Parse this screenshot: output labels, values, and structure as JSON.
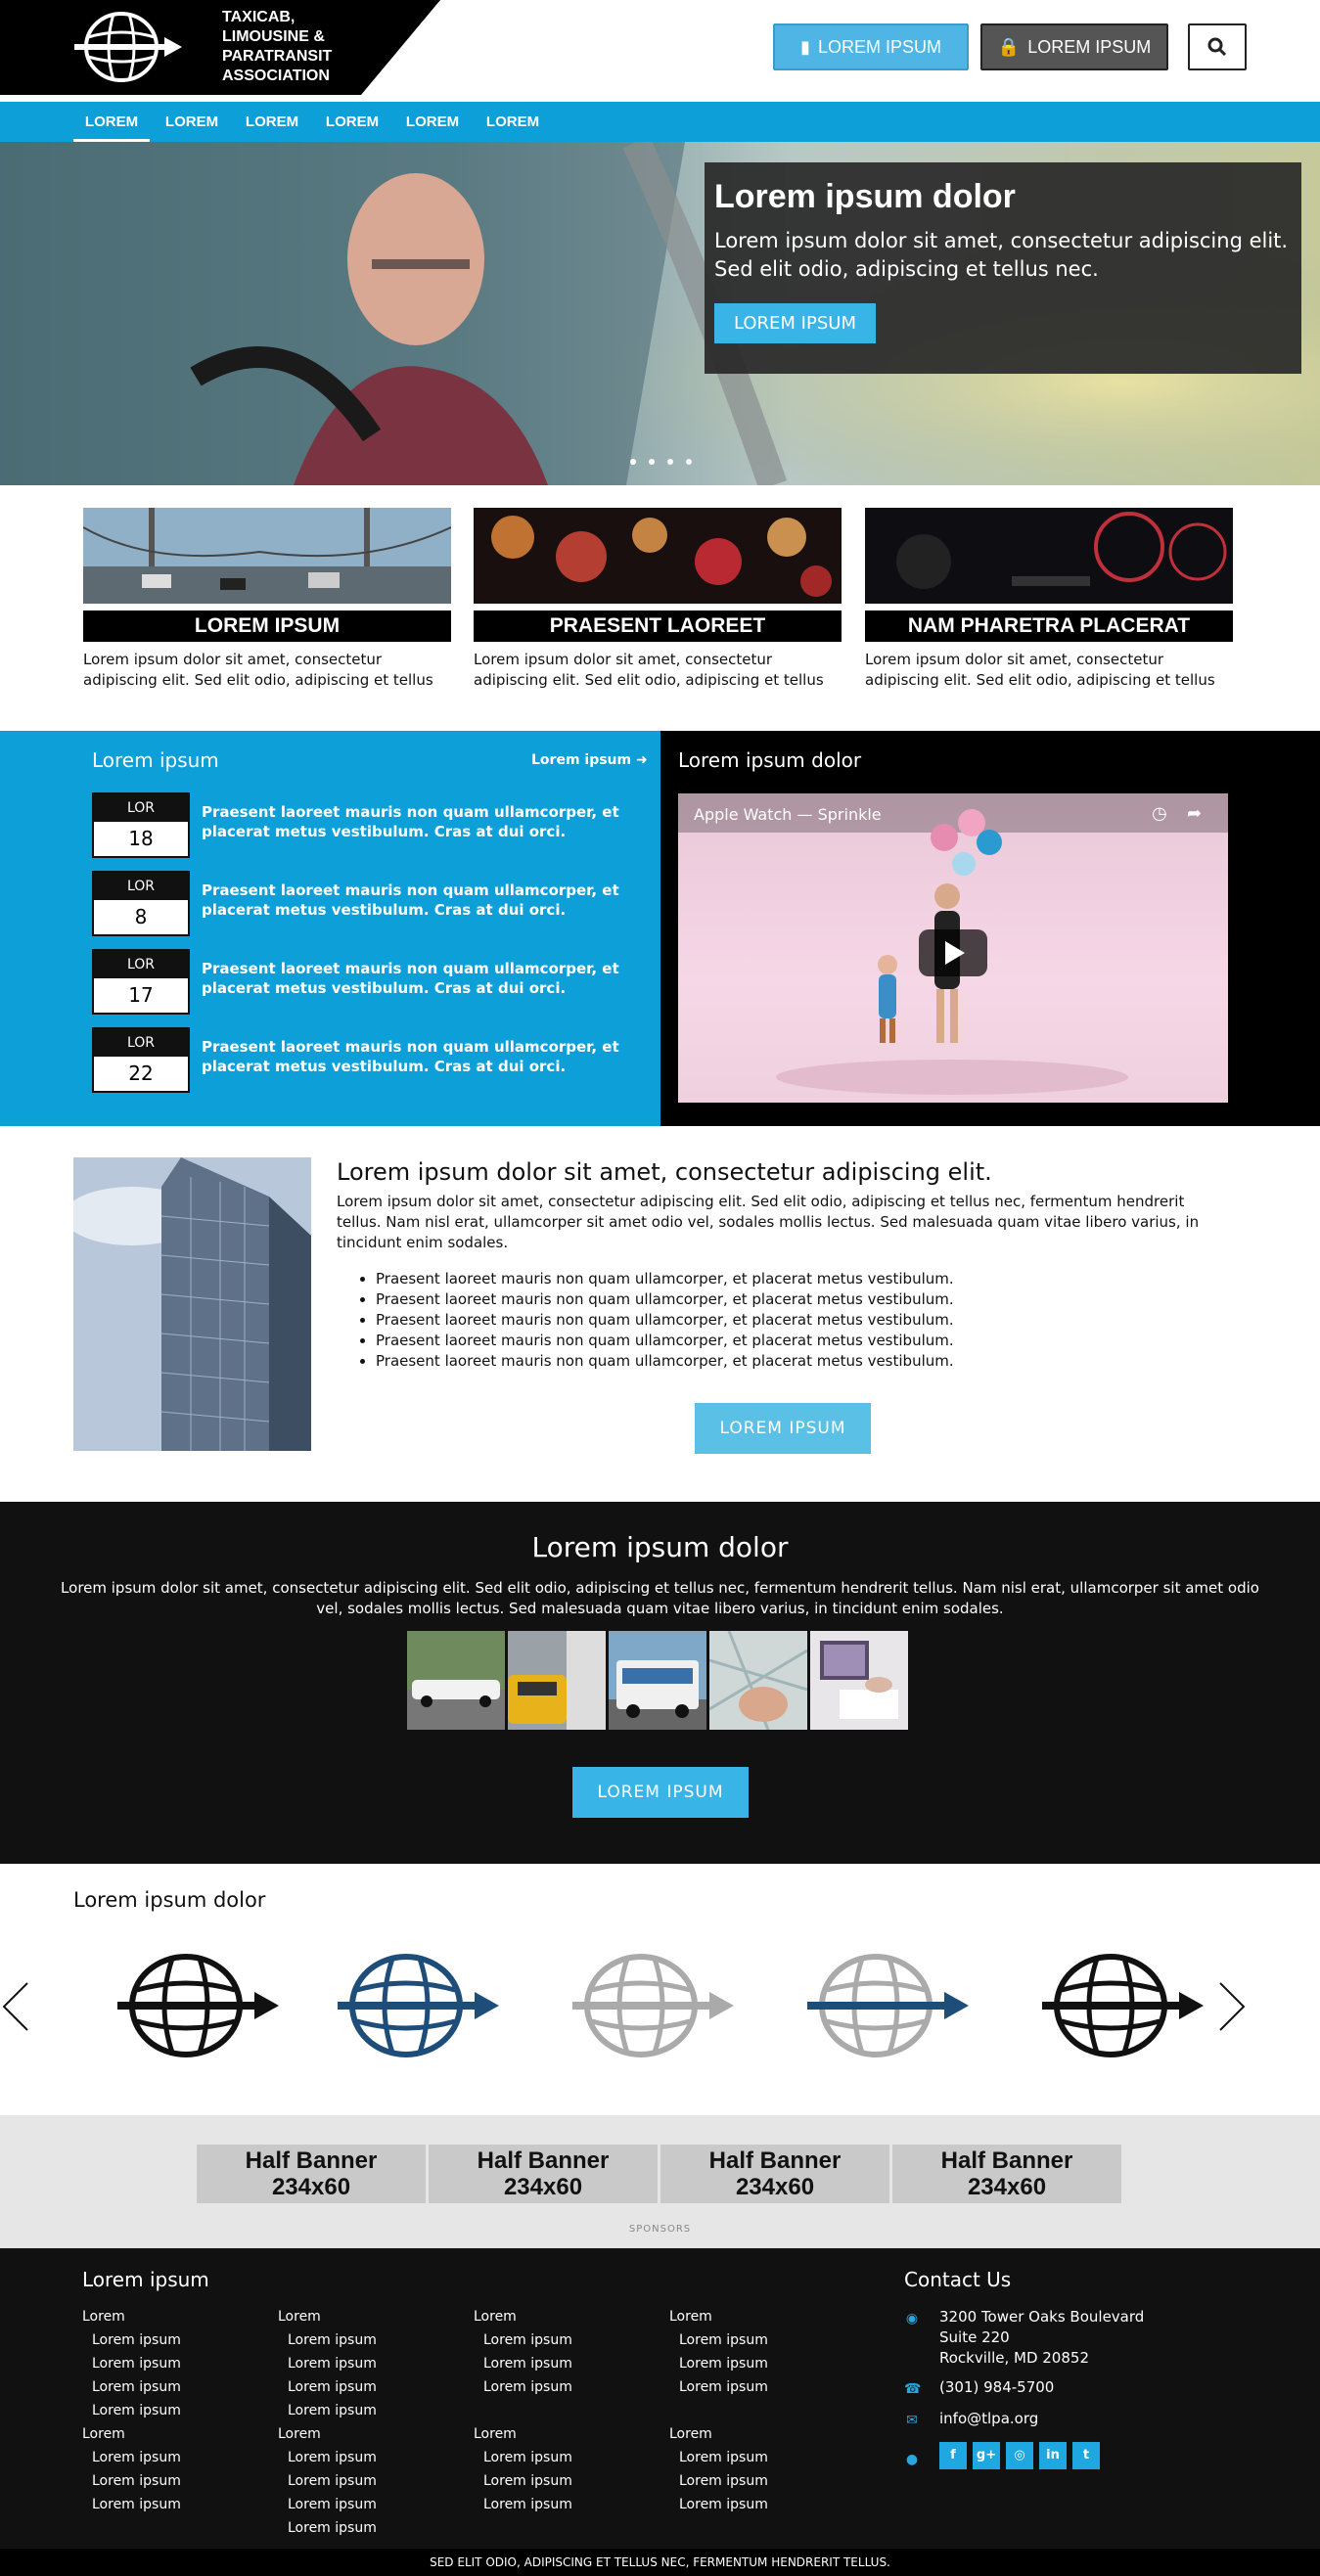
{
  "header": {
    "logo_lines": [
      "TAXICAB,",
      "LIMOUSINE &",
      "PARATRANSIT",
      "ASSOCIATION"
    ],
    "btn_primary": "LOREM IPSUM",
    "btn_secondary": "LOREM IPSUM"
  },
  "nav": {
    "items": [
      "LOREM",
      "LOREM",
      "LOREM",
      "LOREM",
      "LOREM",
      "LOREM"
    ]
  },
  "hero": {
    "title": "Lorem ipsum dolor",
    "text": "Lorem ipsum dolor sit amet, consectetur adipiscing elit. Sed elit odio, adipiscing et tellus nec.",
    "button": "LOREM IPSUM"
  },
  "cards": [
    {
      "title": "LOREM IPSUM",
      "text": "Lorem ipsum dolor sit amet, consectetur adipiscing elit. Sed elit odio, adipiscing et tellus"
    },
    {
      "title": "PRAESENT LAOREET",
      "text": "Lorem ipsum dolor sit amet, consectetur adipiscing elit. Sed elit odio, adipiscing et tellus"
    },
    {
      "title": "NAM PHARETRA PLACERAT",
      "text": "Lorem ipsum dolor sit amet, consectetur adipiscing elit. Sed elit odio, adipiscing et tellus"
    }
  ],
  "events": {
    "title": "Lorem ipsum",
    "more": "Lorem ipsum",
    "items": [
      {
        "month": "LOR",
        "day": "18",
        "text": "Praesent laoreet mauris non quam ullamcorper, et placerat metus vestibulum. Cras at dui orci."
      },
      {
        "month": "LOR",
        "day": "8",
        "text": "Praesent laoreet mauris non quam ullamcorper, et placerat metus vestibulum. Cras at dui orci."
      },
      {
        "month": "LOR",
        "day": "17",
        "text": "Praesent laoreet mauris non quam ullamcorper, et placerat metus vestibulum. Cras at dui orci."
      },
      {
        "month": "LOR",
        "day": "22",
        "text": "Praesent laoreet mauris non quam ullamcorper, et placerat metus vestibulum. Cras at dui orci."
      }
    ]
  },
  "video": {
    "section_title": "Lorem ipsum dolor",
    "title": "Apple Watch — Sprinkle"
  },
  "about": {
    "title": "Lorem ipsum dolor sit amet, consectetur adipiscing elit.",
    "body": "Lorem ipsum dolor sit amet, consectetur adipiscing elit. Sed elit odio, adipiscing et tellus nec, fermentum hendrerit tellus. Nam nisl erat, ullamcorper sit amet odio vel, sodales mollis lectus. Sed malesuada quam vitae libero varius, in tincidunt enim sodales.",
    "list": [
      "Praesent laoreet mauris non quam ullamcorper, et placerat metus vestibulum.",
      "Praesent laoreet mauris non quam ullamcorper, et placerat metus vestibulum.",
      "Praesent laoreet mauris non quam ullamcorper, et placerat metus vestibulum.",
      "Praesent laoreet mauris non quam ullamcorper, et placerat metus vestibulum.",
      "Praesent laoreet mauris non quam ullamcorper, et placerat metus vestibulum."
    ],
    "button": "LOREM IPSUM"
  },
  "gallery": {
    "title": "Lorem ipsum dolor",
    "text": "Lorem ipsum dolor sit amet, consectetur adipiscing elit. Sed elit odio, adipiscing et tellus nec, fermentum hendrerit tellus. Nam nisl erat, ullamcorper sit amet odio vel, sodales mollis lectus. Sed malesuada quam vitae libero varius, in tincidunt enim sodales.",
    "button": "LOREM IPSUM"
  },
  "partners": {
    "title": "Lorem ipsum dolor"
  },
  "sponsors": {
    "banners": [
      {
        "line1": "Half Banner",
        "line2": "234x60"
      },
      {
        "line1": "Half Banner",
        "line2": "234x60"
      },
      {
        "line1": "Half Banner",
        "line2": "234x60"
      },
      {
        "line1": "Half Banner",
        "line2": "234x60"
      }
    ],
    "label": "SPONSORS"
  },
  "footer": {
    "title": "Lorem ipsum",
    "groups": [
      {
        "head": "Lorem",
        "links": [
          "Lorem ipsum",
          "Lorem ipsum",
          "Lorem ipsum",
          "Lorem ipsum"
        ]
      },
      {
        "head": "Lorem",
        "links": [
          "Lorem ipsum",
          "Lorem ipsum",
          "Lorem ipsum",
          "Lorem ipsum"
        ]
      },
      {
        "head": "Lorem",
        "links": [
          "Lorem ipsum",
          "Lorem ipsum",
          "Lorem ipsum"
        ]
      },
      {
        "head": "Lorem",
        "links": [
          "Lorem ipsum",
          "Lorem ipsum",
          "Lorem ipsum"
        ]
      },
      {
        "head": "Lorem",
        "links": [
          "Lorem ipsum",
          "Lorem ipsum",
          "Lorem ipsum"
        ]
      },
      {
        "head": "Lorem",
        "links": [
          "Lorem ipsum",
          "Lorem ipsum",
          "Lorem ipsum",
          "Lorem ipsum"
        ]
      },
      {
        "head": "Lorem",
        "links": [
          "Lorem ipsum",
          "Lorem ipsum",
          "Lorem ipsum"
        ]
      },
      {
        "head": "Lorem",
        "links": [
          "Lorem ipsum",
          "Lorem ipsum",
          "Lorem ipsum"
        ]
      }
    ],
    "contact_title": "Contact Us",
    "address": [
      "3200 Tower Oaks Boulevard",
      "Suite 220",
      "Rockville, MD 20852"
    ],
    "phone": "(301) 984-5700",
    "email": "info@tlpa.org",
    "social": [
      "f",
      "g+",
      "◎",
      "in",
      "t"
    ],
    "copyright": "SED ELIT ODIO, ADIPISCING ET TELLUS NEC, FERMENTUM HENDRERIT TELLUS."
  },
  "colors": {
    "accent": "#0d9fd8",
    "button_blue": "#39b4e6",
    "dark": "#111111"
  }
}
